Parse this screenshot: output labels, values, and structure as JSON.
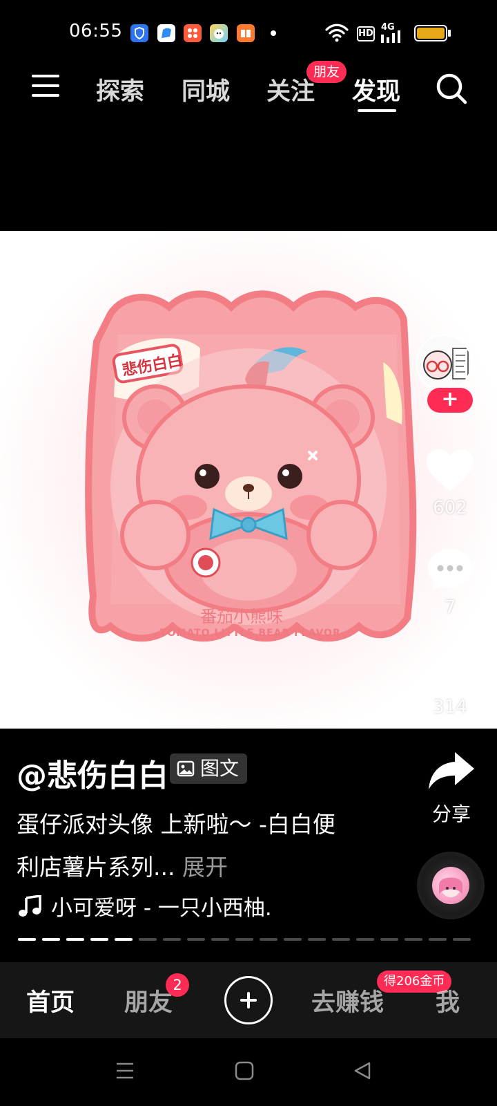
{
  "status_bar": {
    "time": "06:55",
    "network_label": "4G",
    "hd_label": "HD",
    "icons": [
      "shield-app-icon",
      "blue-app-icon",
      "orange-app-icon",
      "game-app-icon",
      "book-app-icon",
      "wifi-icon",
      "signal-icon",
      "battery-icon"
    ]
  },
  "top_nav": {
    "tabs": [
      {
        "label": "探索"
      },
      {
        "label": "同城"
      },
      {
        "label": "关注"
      },
      {
        "label": "发现"
      }
    ],
    "follow_badge": "朋友",
    "active_tab": "发现"
  },
  "media": {
    "brand_label": "悲伤白白",
    "product_cn": "番茄小熊味",
    "product_en": "TOMATO LITTLE BEAR FLAVOR"
  },
  "actions": {
    "follow_symbol": "+",
    "likes": "602",
    "comments": "7",
    "favorites": "314",
    "share_label": "分享"
  },
  "post": {
    "author": "@悲伤白白",
    "type_label": "图文",
    "description": "蛋仔派对头像 上新啦～ -白白便利店薯片系列...",
    "expand_label": "展开",
    "music": "小可爱呀 - 一只小西柚.",
    "progress_total": 19,
    "progress_current": 5
  },
  "bottom_nav": {
    "tabs": [
      {
        "label": "首页"
      },
      {
        "label": "朋友"
      },
      {
        "label": "去赚钱"
      },
      {
        "label": "我"
      }
    ],
    "friend_badge": "2",
    "coin_badge": "得206金币"
  },
  "colors": {
    "accent": "#fe2c55",
    "bag_pink": "#f47a82",
    "bear_pink": "#f9b3b6",
    "bow_blue": "#6cc7e3"
  }
}
